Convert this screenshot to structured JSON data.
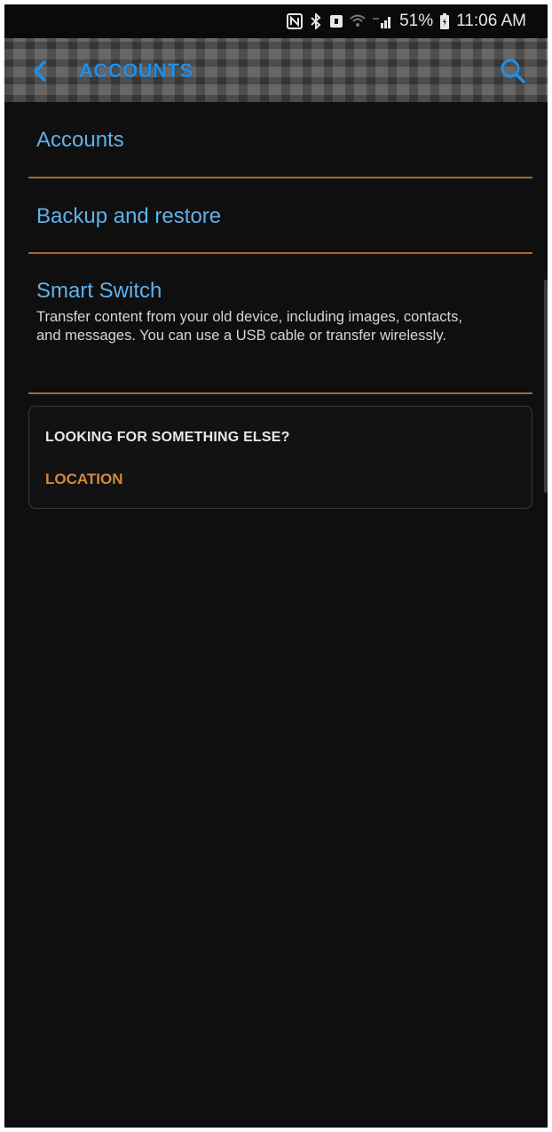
{
  "status_bar": {
    "battery": "51%",
    "time": "11:06 AM",
    "icons": [
      "nfc-icon",
      "bluetooth-icon",
      "alarm-icon",
      "wifi-icon",
      "signal-icon",
      "battery-icon"
    ]
  },
  "app_bar": {
    "title": "ACCOUNTS",
    "back_icon": "chevron-left-icon",
    "search_icon": "search-icon"
  },
  "menu": {
    "items": [
      {
        "title": "Accounts"
      },
      {
        "title": "Backup and restore"
      },
      {
        "title": "Smart Switch",
        "description": "Transfer content from your old device, including images, contacts, and messages. You can use a USB cable or transfer wirelessly."
      }
    ]
  },
  "suggestion": {
    "heading": "LOOKING FOR SOMETHING ELSE?",
    "link": "LOCATION"
  },
  "colors": {
    "accent_blue": "#5fb1ec",
    "title_blue": "#1f8fe8",
    "divider_orange": "#a8682a",
    "link_orange": "#d08a3a",
    "background": "#0f0f0f"
  }
}
